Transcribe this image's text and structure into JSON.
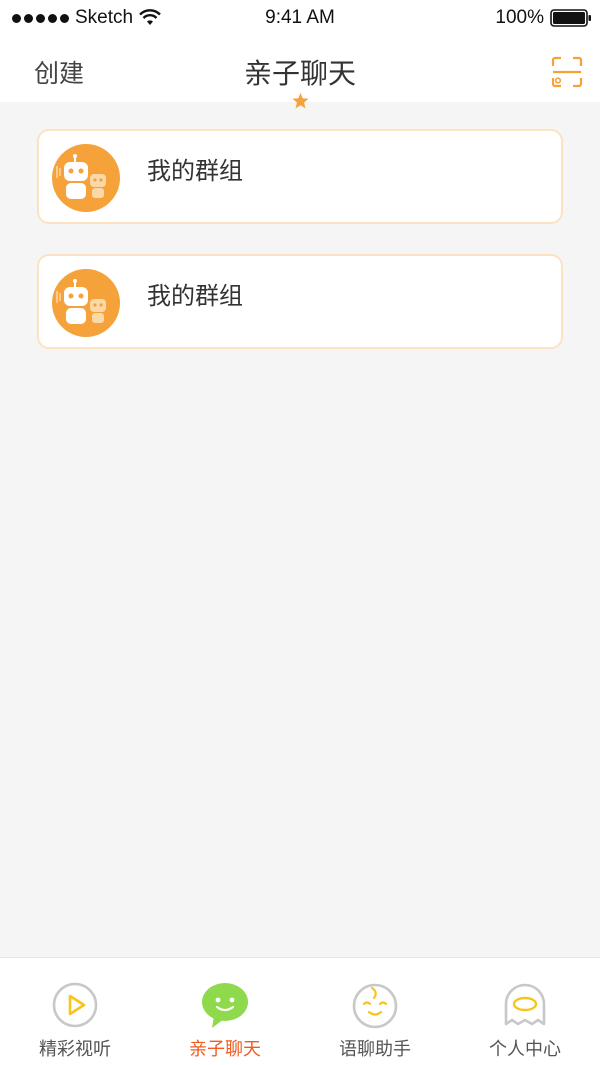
{
  "status_bar": {
    "carrier": "Sketch",
    "time": "9:41 AM",
    "battery": "100%"
  },
  "nav": {
    "left_label": "创建",
    "title": "亲子聊天",
    "star_icon": "star-icon",
    "right_icon": "scan-icon"
  },
  "groups": [
    {
      "title": "我的群组",
      "avatar_icon": "robot-avatar-icon"
    },
    {
      "title": "我的群组",
      "avatar_icon": "robot-avatar-icon"
    }
  ],
  "tabs": [
    {
      "label": "精彩视听",
      "icon": "play-icon",
      "active": false
    },
    {
      "label": "亲子聊天",
      "icon": "chat-bubble-icon",
      "active": true
    },
    {
      "label": "语聊助手",
      "icon": "baby-face-icon",
      "active": false
    },
    {
      "label": "个人中心",
      "icon": "user-center-icon",
      "active": false
    }
  ],
  "colors": {
    "accent_orange": "#f5a23a",
    "active_tab": "#f25a1e",
    "chat_green": "#8ed94c",
    "card_border": "#fbe3c2",
    "background": "#f5f5f5"
  }
}
